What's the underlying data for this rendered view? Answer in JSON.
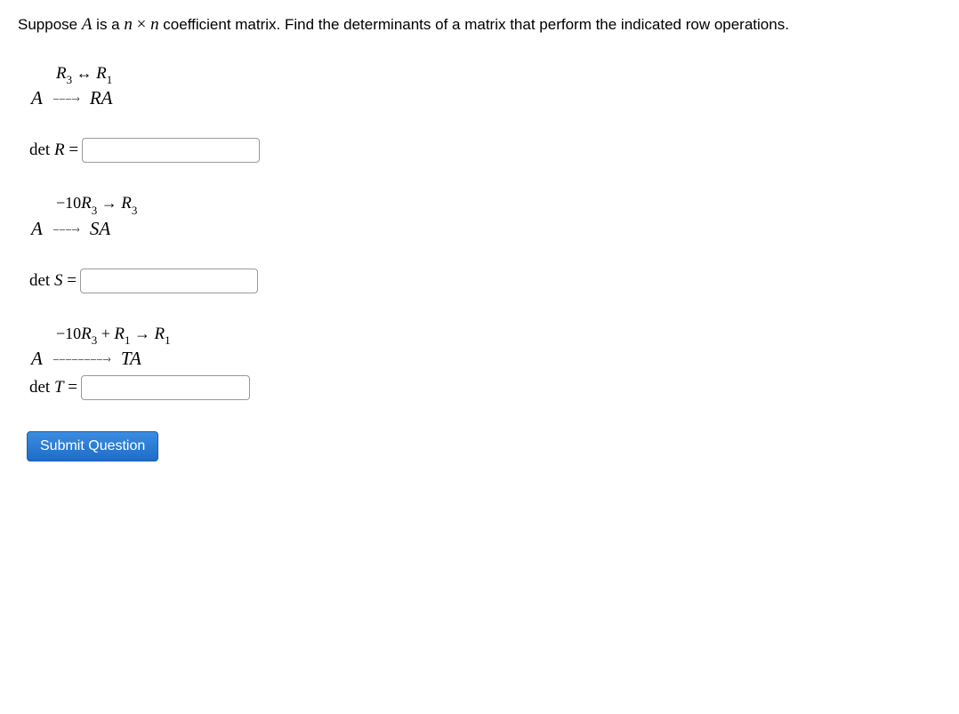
{
  "question": {
    "prefix": "Suppose ",
    "matrix_var": "A",
    "middle1": " is a ",
    "dim_n1": "n",
    "times": " × ",
    "dim_n2": "n",
    "suffix": " coefficient matrix. Find the determinants of a matrix that perform the indicated row operations."
  },
  "problems": [
    {
      "row_op_html": "<span class='math-italic'>R</span><span class='sub'>3</span> ↔ <span class='math-italic'>R</span><span class='sub'>1</span>",
      "lhs": "A",
      "arrow": "– – – –›",
      "rhs": "RA",
      "det_label": "det",
      "det_var": "R",
      "equals": "=",
      "input_value": ""
    },
    {
      "row_op_html": "−10<span class='math-italic'>R</span><span class='sub'>3</span> → <span class='math-italic'>R</span><span class='sub'>3</span>",
      "lhs": "A",
      "arrow": "– – – –›",
      "rhs": "SA",
      "det_label": "det",
      "det_var": "S",
      "equals": "=",
      "input_value": ""
    },
    {
      "row_op_html": "−10<span class='math-italic'>R</span><span class='sub'>3</span> + <span class='math-italic'>R</span><span class='sub'>1</span> → <span class='math-italic'>R</span><span class='sub'>1</span>",
      "lhs": "A",
      "arrow": "– – – – – – – – –›",
      "rhs": "TA",
      "det_label": "det",
      "det_var": "T",
      "equals": "=",
      "input_value": ""
    }
  ],
  "submit_label": "Submit Question"
}
